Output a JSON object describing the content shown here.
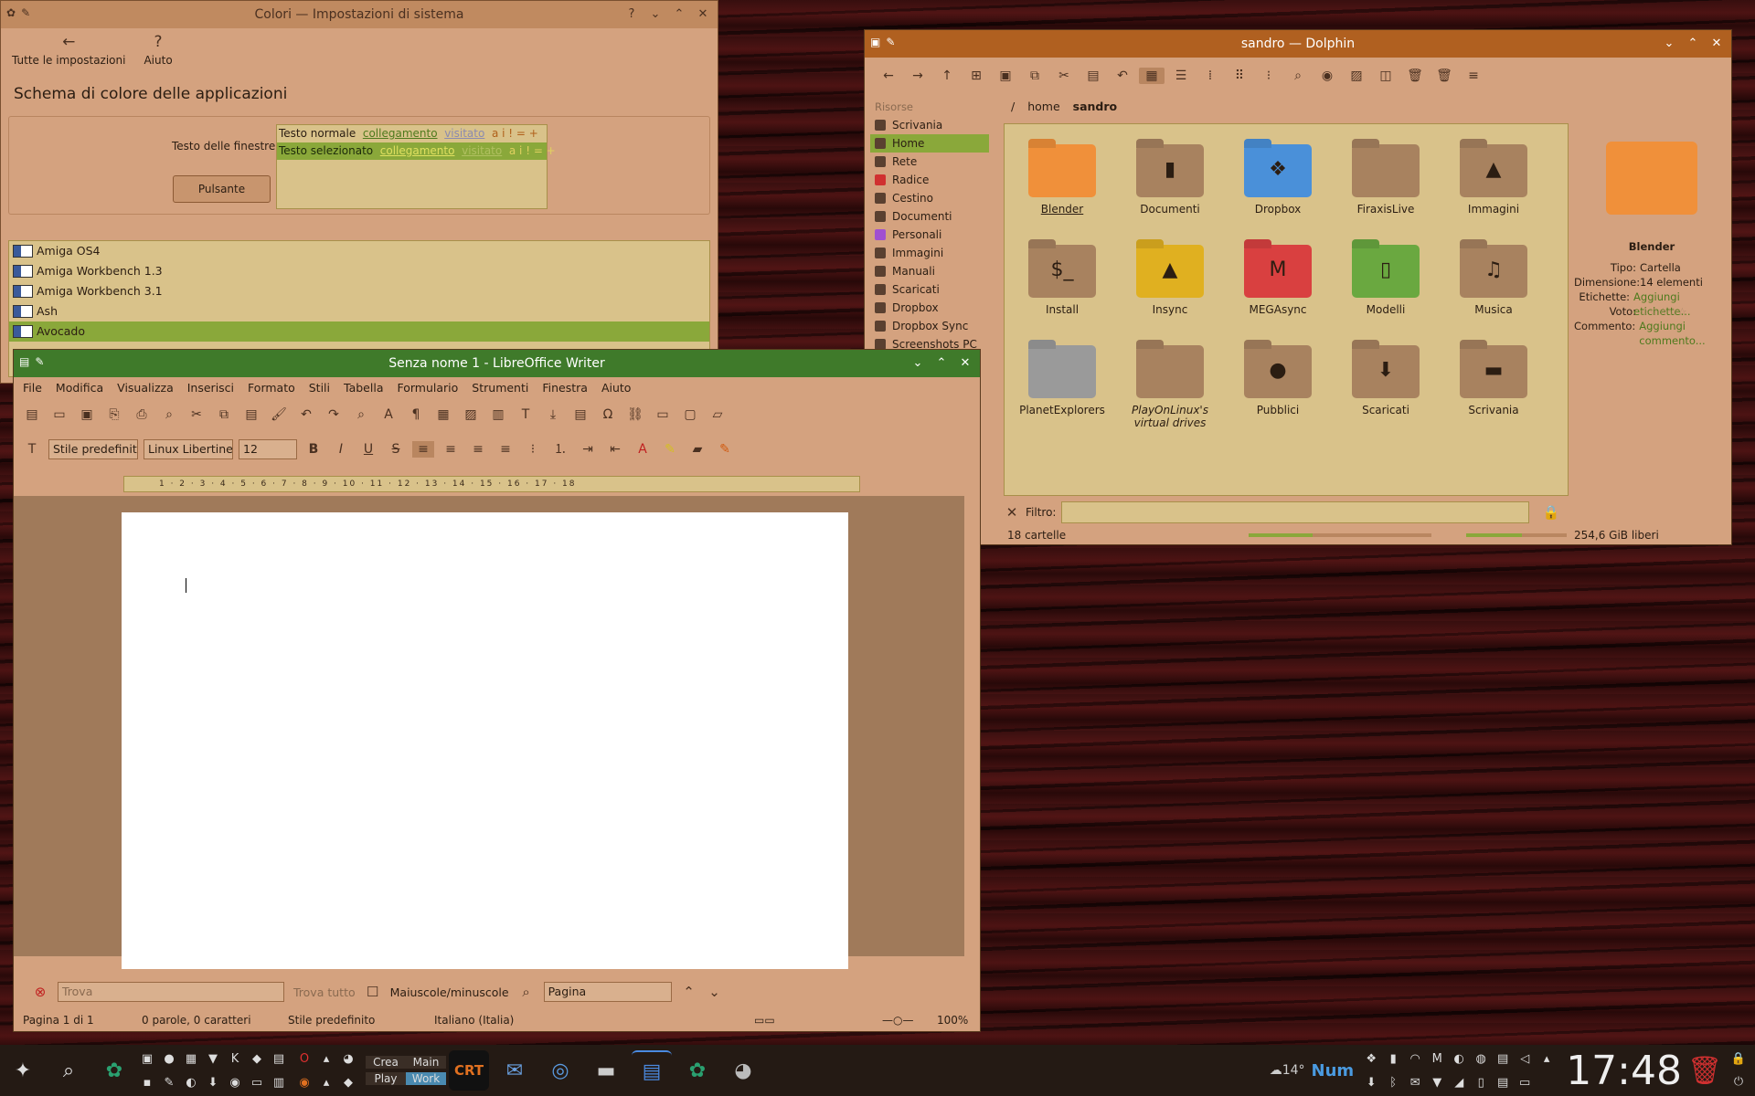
{
  "colors_window": {
    "title": "Colori — Impostazioni di sistema",
    "nav_back": "Tutte le impostazioni",
    "nav_help": "Aiuto",
    "heading": "Schema di colore delle applicazioni",
    "preview_label": "Testo delle finestre",
    "preview_button": "Pulsante",
    "normal_text": "Testo normale",
    "selected_text": "Testo selezionato",
    "link": "collegamento",
    "visited": "visitato",
    "symbols": "a i ! = +",
    "schemes": [
      "Amiga OS4",
      "Amiga Workbench 1.3",
      "Amiga Workbench 3.1",
      "Ash",
      "Avocado"
    ],
    "selected_scheme": "Avocado"
  },
  "dolphin": {
    "title": "sandro — Dolphin",
    "places_header": "Risorse",
    "places": [
      "Scrivania",
      "Home",
      "Rete",
      "Radice",
      "Cestino",
      "Documenti",
      "Personali",
      "Immagini",
      "Manuali",
      "Scaricati",
      "Dropbox",
      "Dropbox Sync",
      "Screenshots PC"
    ],
    "selected_place": "Home",
    "breadcrumb": [
      "/",
      "home",
      "sandro"
    ],
    "folders": [
      {
        "name": "Blender",
        "color": "#f0903a",
        "glyph": ""
      },
      {
        "name": "Documenti",
        "color": "#a8825f",
        "glyph": "▮"
      },
      {
        "name": "Dropbox",
        "color": "#4a90d9",
        "glyph": "❖"
      },
      {
        "name": "FiraxisLive",
        "color": "#a8825f",
        "glyph": ""
      },
      {
        "name": "Immagini",
        "color": "#a8825f",
        "glyph": "▲"
      },
      {
        "name": "Install",
        "color": "#a8825f",
        "glyph": "$_"
      },
      {
        "name": "Insync",
        "color": "#e0b020",
        "glyph": "▲"
      },
      {
        "name": "MEGAsync",
        "color": "#d94040",
        "glyph": "M"
      },
      {
        "name": "Modelli",
        "color": "#6aa840",
        "glyph": "▯"
      },
      {
        "name": "Musica",
        "color": "#a8825f",
        "glyph": "♫"
      },
      {
        "name": "PlanetExplorers",
        "color": "#9a9a9a",
        "glyph": ""
      },
      {
        "name": "PlayOnLinux's virtual drives",
        "color": "#a8825f",
        "glyph": ""
      },
      {
        "name": "Pubblici",
        "color": "#a8825f",
        "glyph": "●"
      },
      {
        "name": "Scaricati",
        "color": "#a8825f",
        "glyph": "⬇"
      },
      {
        "name": "Scrivania",
        "color": "#a8825f",
        "glyph": "▬"
      }
    ],
    "info": {
      "name": "Blender",
      "rows": [
        {
          "k": "Tipo:",
          "v": "Cartella"
        },
        {
          "k": "Dimensione:",
          "v": "14 elementi"
        },
        {
          "k": "Etichette:",
          "v": "Aggiungi etichette..."
        },
        {
          "k": "Voto:",
          "v": "☆☆☆☆☆"
        },
        {
          "k": "Commento:",
          "v": "Aggiungi commento..."
        }
      ]
    },
    "filter_label": "Filtro:",
    "folder_count": "18 cartelle",
    "free_space": "254,6 GiB liberi",
    "free_fraction": 0.55,
    "zoom_fraction": 0.35
  },
  "writer": {
    "title": "Senza nome 1 - LibreOffice Writer",
    "menu": [
      "File",
      "Modifica",
      "Visualizza",
      "Inserisci",
      "Formato",
      "Stili",
      "Tabella",
      "Formulario",
      "Strumenti",
      "Finestra",
      "Aiuto"
    ],
    "para_style": "Stile predefinito",
    "font_name": "Linux Libertine G",
    "font_size": "12",
    "ruler": "1 · 2 · 3 · 4 · 5 · 6 · 7 · 8 · 9 · 10 · 11 · 12 · 13 · 14 · 15 · 16 · 17 · 18",
    "find_placeholder": "Trova",
    "find_all": "Trova tutto",
    "match_case": "Maiuscole/minuscole",
    "nav_target": "Pagina",
    "status_page": "Pagina 1 di 1",
    "status_words": "0 parole, 0 caratteri",
    "status_style": "Stile predefinito",
    "status_lang": "Italiano (Italia)",
    "status_zoom": "100%"
  },
  "taskbar": {
    "activities_top": "Crea",
    "activities_bottom": "Play",
    "activities_top2": "Main",
    "activities_bottom2": "Work",
    "crt_label": "CRT",
    "weather": "14°",
    "num_lock": "Num",
    "clock": "17:48"
  }
}
